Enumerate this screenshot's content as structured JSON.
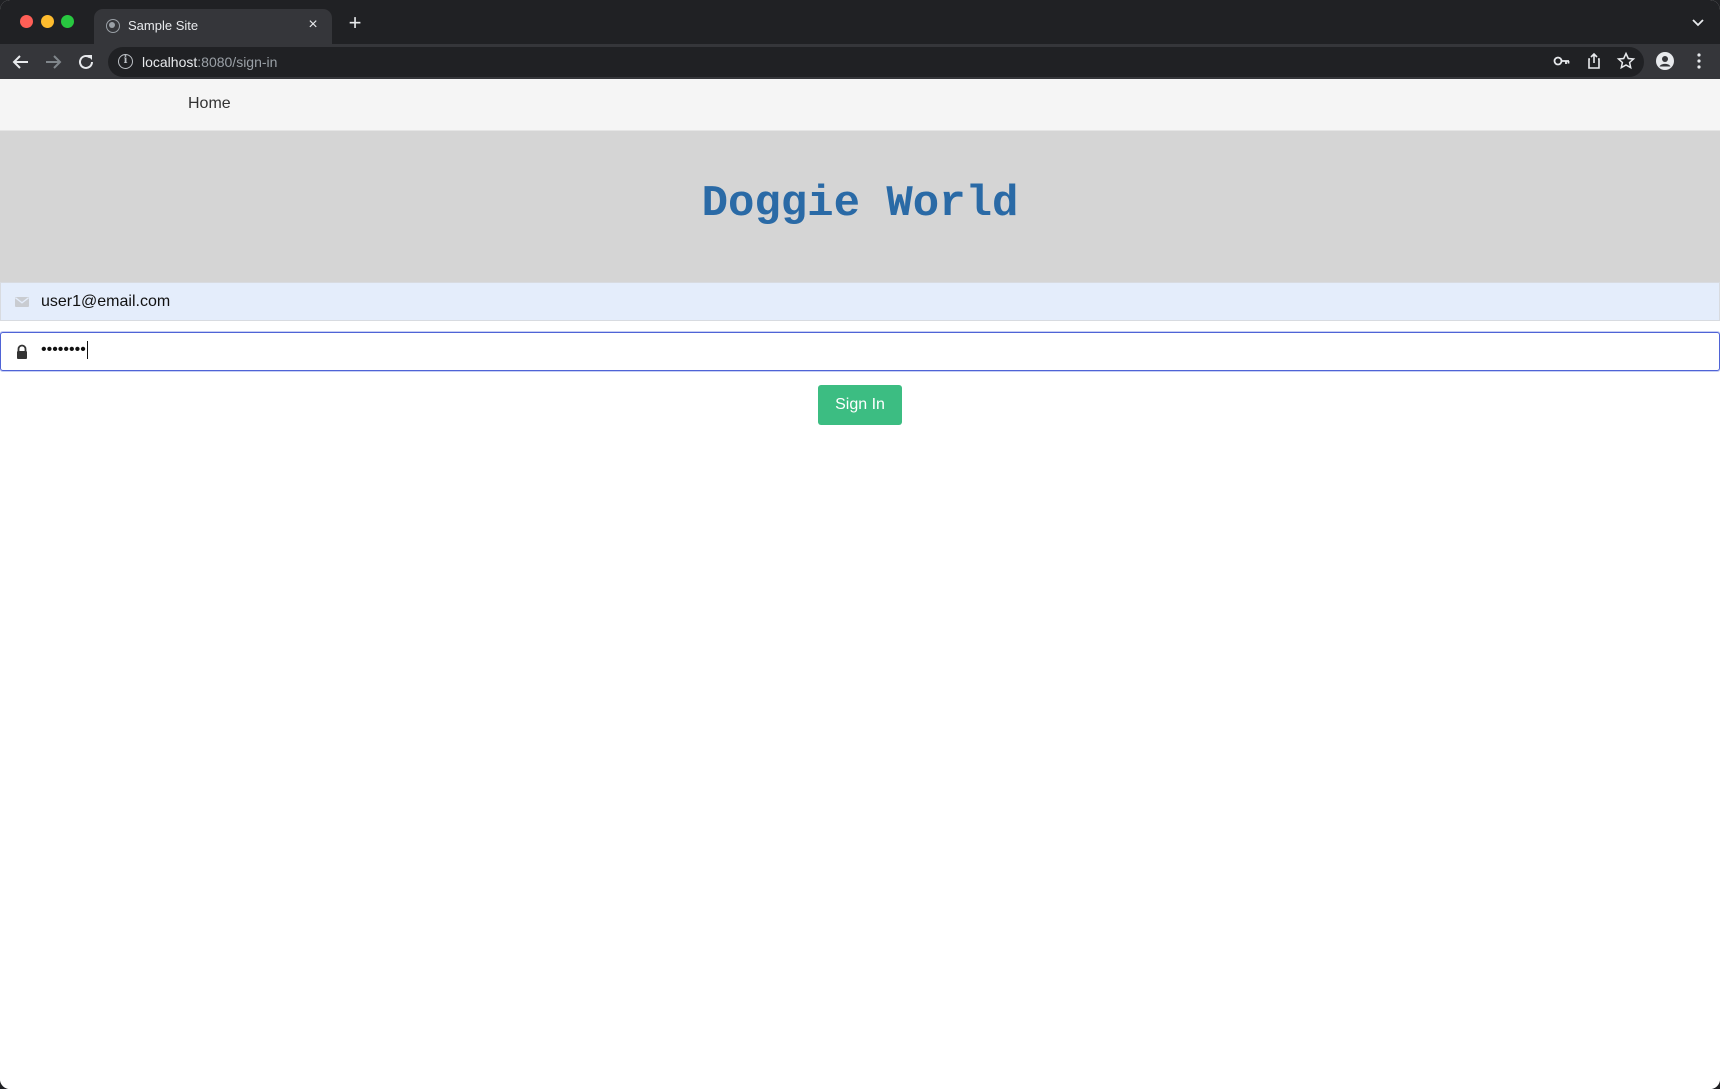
{
  "browser": {
    "tab_title": "Sample Site",
    "tab_close": "×",
    "new_tab": "+",
    "url_host": "localhost",
    "url_path": ":8080/sign-in"
  },
  "navbar": {
    "home_label": "Home"
  },
  "hero": {
    "title": "Doggie World"
  },
  "form": {
    "email_value": "user1@email.com",
    "password_mask": "••••••••",
    "submit_label": "Sign In"
  },
  "colors": {
    "title": "#2a6aa6",
    "button": "#3cbd82",
    "hero_bg": "#d5d5d5",
    "email_autofill_bg": "#e4edfb",
    "focus_border": "#4f63d6"
  }
}
